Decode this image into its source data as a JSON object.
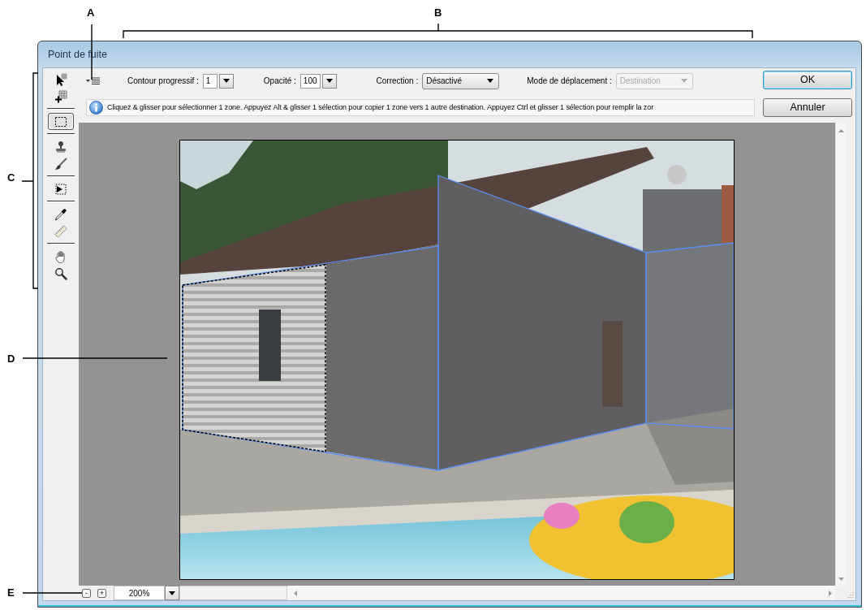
{
  "callouts": [
    {
      "label": "A",
      "kind": "pointer-down"
    },
    {
      "label": "B",
      "kind": "bracket-top"
    },
    {
      "label": "C",
      "kind": "bracket-left"
    },
    {
      "label": "D",
      "kind": "pointer-right"
    },
    {
      "label": "E",
      "kind": "pointer-right"
    }
  ],
  "window": {
    "title": "Point de fuite"
  },
  "tool_groups": [
    {
      "tools": [
        {
          "selected": false
        },
        {
          "selected": false
        }
      ]
    },
    {
      "tools": [
        {
          "selected": true
        }
      ]
    },
    {
      "tools": [
        {
          "selected": false
        },
        {
          "selected": false
        }
      ]
    },
    {
      "tools": [
        {
          "selected": false
        }
      ]
    },
    {
      "tools": [
        {
          "selected": false
        },
        {
          "selected": false
        }
      ]
    },
    {
      "tools": [
        {
          "selected": false
        },
        {
          "selected": false
        }
      ]
    }
  ],
  "options": [
    {
      "kind": "combo",
      "label": "Contour progressif :",
      "value": "1",
      "disabled": false
    },
    {
      "kind": "combo",
      "label": "Opacité :",
      "value": "100",
      "disabled": false
    },
    {
      "kind": "dropdown",
      "label": "Correction :",
      "value": "Désactivé",
      "disabled": false
    },
    {
      "kind": "dropdown",
      "label": "Mode de déplacement :",
      "value": "Destination",
      "disabled": true
    }
  ],
  "info_message": "Cliquez & glisser pour sélectionner 1 zone. Appuyez Alt & glisser 1 sélection pour copier 1 zone vers 1 autre destination. Appuyez Ctrl et glisser 1 sélection pour remplir la zor",
  "buttons": [
    {
      "label": "OK",
      "default": true
    },
    {
      "label": "Annuler",
      "default": false
    }
  ],
  "zoom": {
    "out": "-",
    "in": "+",
    "value": "200%"
  }
}
